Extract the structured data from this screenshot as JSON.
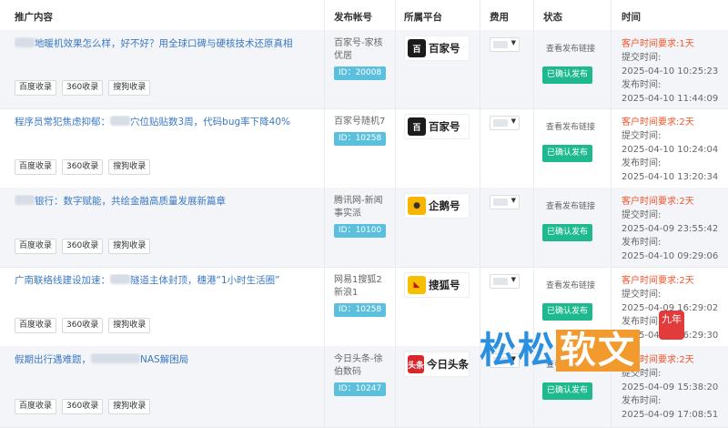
{
  "headers": {
    "content": "推广内容",
    "account": "发布帐号",
    "platform": "所属平台",
    "fee": "费用",
    "status": "状态",
    "time": "时间"
  },
  "tag_labels": [
    "百度收录",
    "360收录",
    "搜狗收录"
  ],
  "rows": [
    {
      "title_pre": "",
      "title_post": "地暖机效果怎么样，好不好？用全球口碑与硬核技术还原真相",
      "account_name": "百家号-家核优居",
      "account_id": "ID：20008",
      "platform_name": "百家号",
      "platform_icon": "baijiahao-icon",
      "view_link": "查看发布链接",
      "status": "已确认发布",
      "req": "客户时间要求:1天",
      "submit_label": "提交时间:",
      "submit_time": "2025-04-10 10:25:23",
      "publish_label": "发布时间:",
      "publish_time": "2025-04-10 11:44:09"
    },
    {
      "title_pre": "程序员常犯焦虑抑郁：",
      "title_post": "穴位贴贴数3周，代码bug率下降40%",
      "account_name": "百家号随机7",
      "account_id": "ID：10258",
      "platform_name": "百家号",
      "platform_icon": "baijiahao-icon",
      "view_link": "查看发布链接",
      "status": "已确认发布",
      "req": "客户时间要求:2天",
      "submit_label": "提交时间:",
      "submit_time": "2025-04-10 10:24:04",
      "publish_label": "发布时间:",
      "publish_time": "2025-04-10 13:20:34"
    },
    {
      "title_pre": "",
      "title_post": "银行：数字赋能，共绘金融高质量发展新篇章",
      "account_name": "腾讯网-新闻事实派",
      "account_id": "ID：10100",
      "platform_name": "企鹅号",
      "platform_icon": "penguin-icon",
      "view_link": "查看发布链接",
      "status": "已确认发布",
      "req": "客户时间要求:2天",
      "submit_label": "提交时间:",
      "submit_time": "2025-04-09 23:55:42",
      "publish_label": "发布时间:",
      "publish_time": "2025-04-10 09:29:06"
    },
    {
      "title_pre": "广南联络线建设加速：",
      "title_post": "隧道主体封顶，穗港“1小时生活圈”",
      "account_name": "网易1搜狐2新浪1",
      "account_id": "ID：10258",
      "platform_name": "搜狐号",
      "platform_icon": "sohu-fox-icon",
      "view_link": "查看发布链接",
      "status": "已确认发布",
      "req": "客户时间要求:2天",
      "submit_label": "提交时间:",
      "submit_time": "2025-04-09 16:29:02",
      "publish_label": "发布时间:",
      "publish_time": "2025-04-09 16:29:30"
    },
    {
      "title_pre": "假期出行遇难题，",
      "title_post": "NAS解困局",
      "account_name": "今日头条-徐伯数码",
      "account_id": "ID：10247",
      "platform_name": "今日头条",
      "platform_icon": "toutiao-icon",
      "view_link": "查看发布链接",
      "status": "已确认发布",
      "req": "客户时间要求:2天",
      "submit_label": "提交时间:",
      "submit_time": "2025-04-09 15:38:20",
      "publish_label": "发布时间:",
      "publish_time": "2025-04-09 17:08:51"
    }
  ],
  "watermark": {
    "a": "松松",
    "b": "软文",
    "seal": "九年"
  },
  "colors": {
    "link": "#3b78c4",
    "status_green": "#1fb990",
    "id_badge": "#5bc0de",
    "required": "#f2552c"
  }
}
